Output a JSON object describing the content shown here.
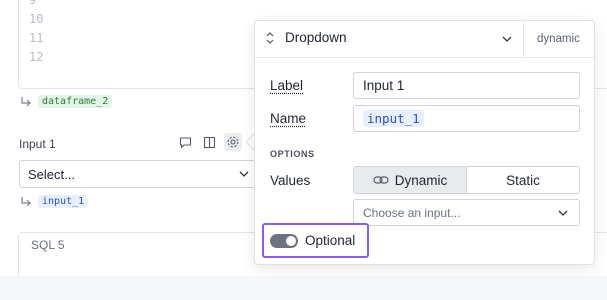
{
  "code_cell": {
    "line_numbers": [
      "9",
      "10",
      "11",
      "12"
    ],
    "output_ref": "dataframe_2"
  },
  "input_cell": {
    "title": "Input 1",
    "select_placeholder": "Select...",
    "output_ref": "input_1",
    "tools": [
      "comment-icon",
      "layout-icon",
      "gear-icon"
    ]
  },
  "sql_cell": {
    "title": "SQL 5"
  },
  "popover": {
    "type_label": "Dropdown",
    "mode_tag": "dynamic",
    "label_field": {
      "label": "Label",
      "value": "Input 1"
    },
    "name_field": {
      "label": "Name",
      "value": "input_1"
    },
    "options_heading": "OPTIONS",
    "values_label": "Values",
    "values_toggle": {
      "dynamic": "Dynamic",
      "static": "Static",
      "selected": "Dynamic"
    },
    "choose_input_placeholder": "Choose an input...",
    "optional": {
      "label": "Optional",
      "enabled": true
    }
  },
  "colors": {
    "highlight_border": "#8a5cf6",
    "green_chip": "#e3f5e6",
    "blue_chip": "#e8efff"
  }
}
